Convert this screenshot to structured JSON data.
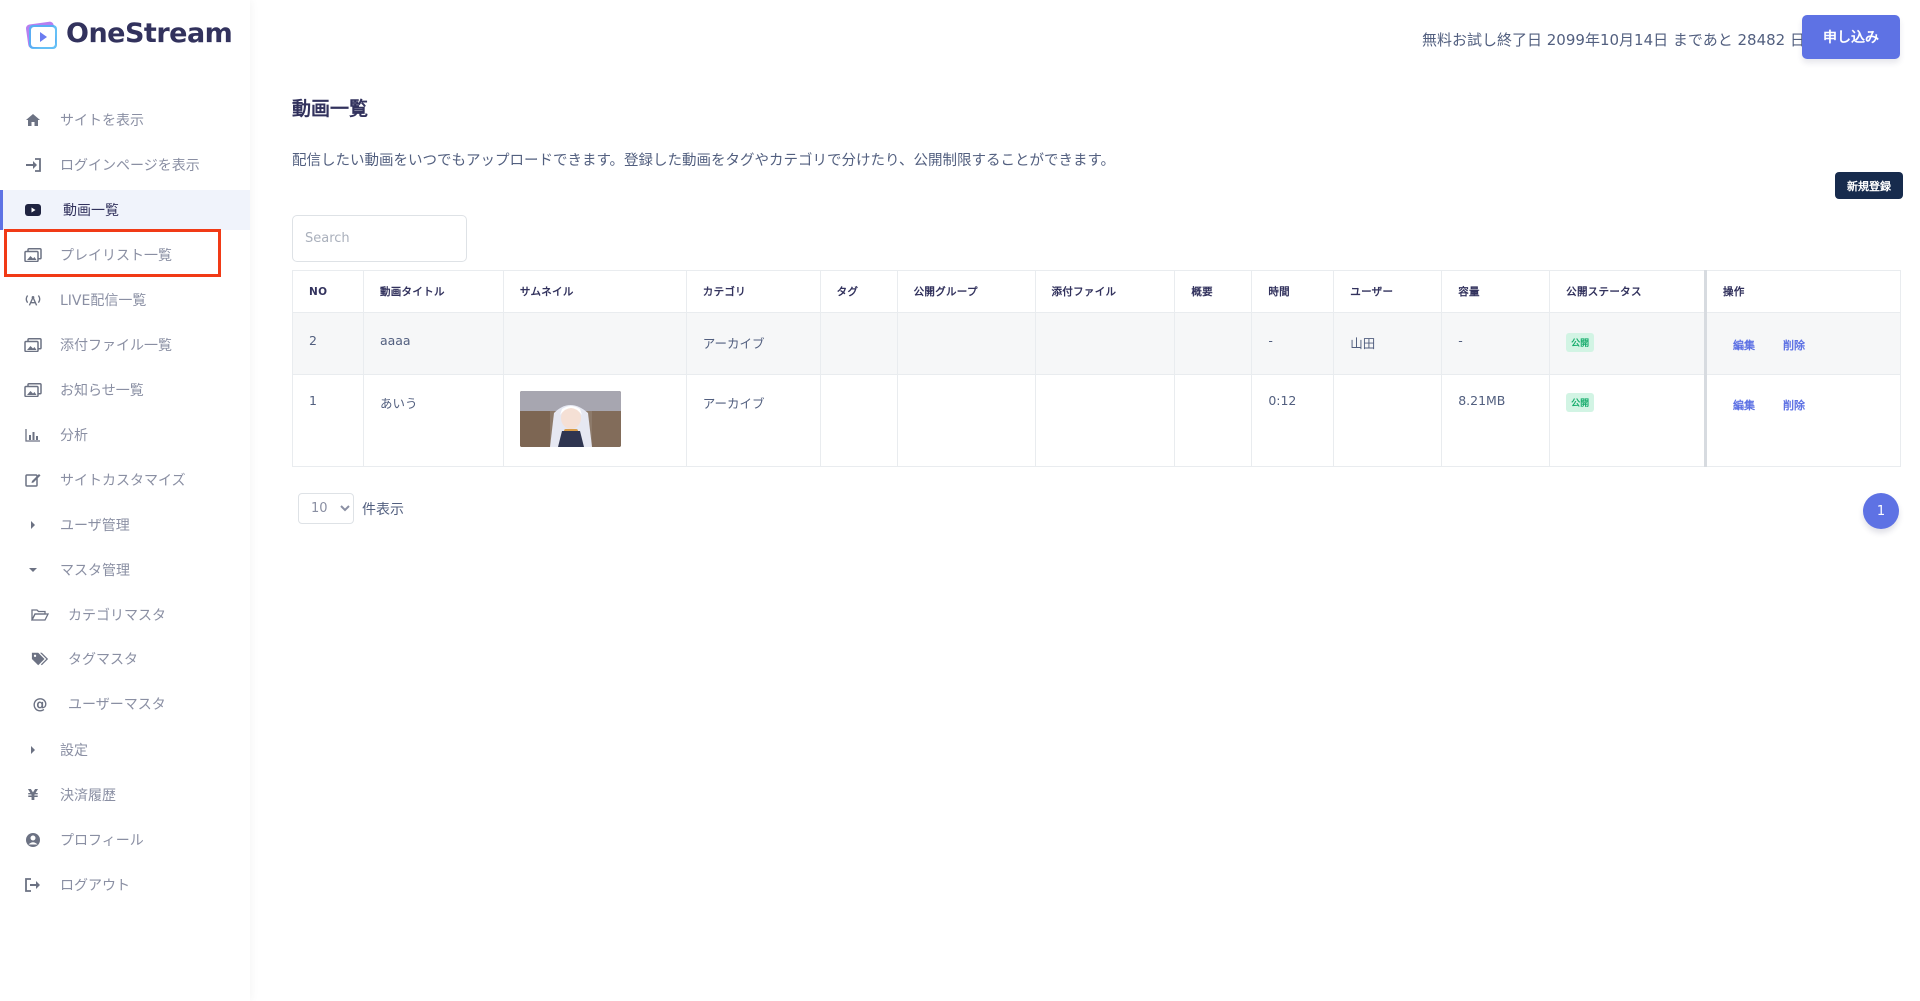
{
  "app": {
    "name": "OneStream"
  },
  "sidebar": {
    "items": [
      {
        "label": "サイトを表示",
        "icon": "home-icon",
        "glyph": "⌂"
      },
      {
        "label": "ログインページを表示",
        "icon": "sign-in-icon",
        "glyph": "⇥"
      },
      {
        "label": "動画一覧",
        "icon": "youtube-play-icon",
        "glyph": "▶"
      },
      {
        "label": "プレイリスト一覧",
        "icon": "images-icon",
        "glyph": "▣"
      },
      {
        "label": "LIVE配信一覧",
        "icon": "broadcast-tower-icon",
        "glyph": "((A))"
      },
      {
        "label": "添付ファイル一覧",
        "icon": "images-icon",
        "glyph": "▣"
      },
      {
        "label": "お知らせ一覧",
        "icon": "images-icon",
        "glyph": "▣"
      },
      {
        "label": "分析",
        "icon": "bar-chart-icon",
        "glyph": "▥"
      },
      {
        "label": "サイトカスタマイズ",
        "icon": "edit-icon",
        "glyph": "✎"
      },
      {
        "label": "ユーザ管理",
        "icon": "caret-right-icon",
        "glyph": "▸"
      },
      {
        "label": "マスタ管理",
        "icon": "caret-down-icon",
        "glyph": "▾"
      },
      {
        "label": "カテゴリマスタ",
        "icon": "folder-open-icon",
        "glyph": "🗁"
      },
      {
        "label": "タグマスタ",
        "icon": "tags-icon",
        "glyph": "◆"
      },
      {
        "label": "ユーザーマスタ",
        "icon": "at-icon",
        "glyph": "@"
      },
      {
        "label": "設定",
        "icon": "caret-right-icon",
        "glyph": "▸"
      },
      {
        "label": "決済履歴",
        "icon": "yen-icon",
        "glyph": "¥"
      },
      {
        "label": "プロフィール",
        "icon": "user-circle-icon",
        "glyph": "●"
      },
      {
        "label": "ログアウト",
        "icon": "sign-out-icon",
        "glyph": "⇤"
      }
    ]
  },
  "header": {
    "trial_text": "無料お試し終了日 2099年10月14日 まであと 28482 日",
    "apply_label": "申し込み"
  },
  "main": {
    "title": "動画一覧",
    "description": "配信したい動画をいつでもアップロードできます。登録した動画をタグやカテゴリで分けたり、公開制限することができます。",
    "new_label": "新規登録",
    "search_placeholder": "Search"
  },
  "table": {
    "columns": [
      "NO",
      "動画タイトル",
      "サムネイル",
      "カテゴリ",
      "タグ",
      "公開グループ",
      "添付ファイル",
      "概要",
      "時間",
      "ユーザー",
      "容量",
      "公開ステータス",
      "操作"
    ],
    "rows": [
      {
        "no": "2",
        "title": "aaaa",
        "thumbnail": "",
        "category": "アーカイブ",
        "tag": "",
        "group": "",
        "attachment": "",
        "summary": "",
        "duration": "-",
        "user": "山田",
        "size": "-",
        "status": "公開",
        "edit": "編集",
        "delete": "削除"
      },
      {
        "no": "1",
        "title": "あいう",
        "thumbnail": "anime-girl-thumbnail",
        "category": "アーカイブ",
        "tag": "",
        "group": "",
        "attachment": "",
        "summary": "",
        "duration": "0:12",
        "user": "",
        "size": "8.21MB",
        "status": "公開",
        "edit": "編集",
        "delete": "削除"
      }
    ]
  },
  "pagination": {
    "page_size": "10",
    "page_size_label": "件表示",
    "current_page": "1"
  },
  "colors": {
    "accent": "#5e72e4",
    "highlight": "#f13a16",
    "status_badge_bg": "#d2f4e4",
    "status_badge_text": "#1aae6f"
  }
}
